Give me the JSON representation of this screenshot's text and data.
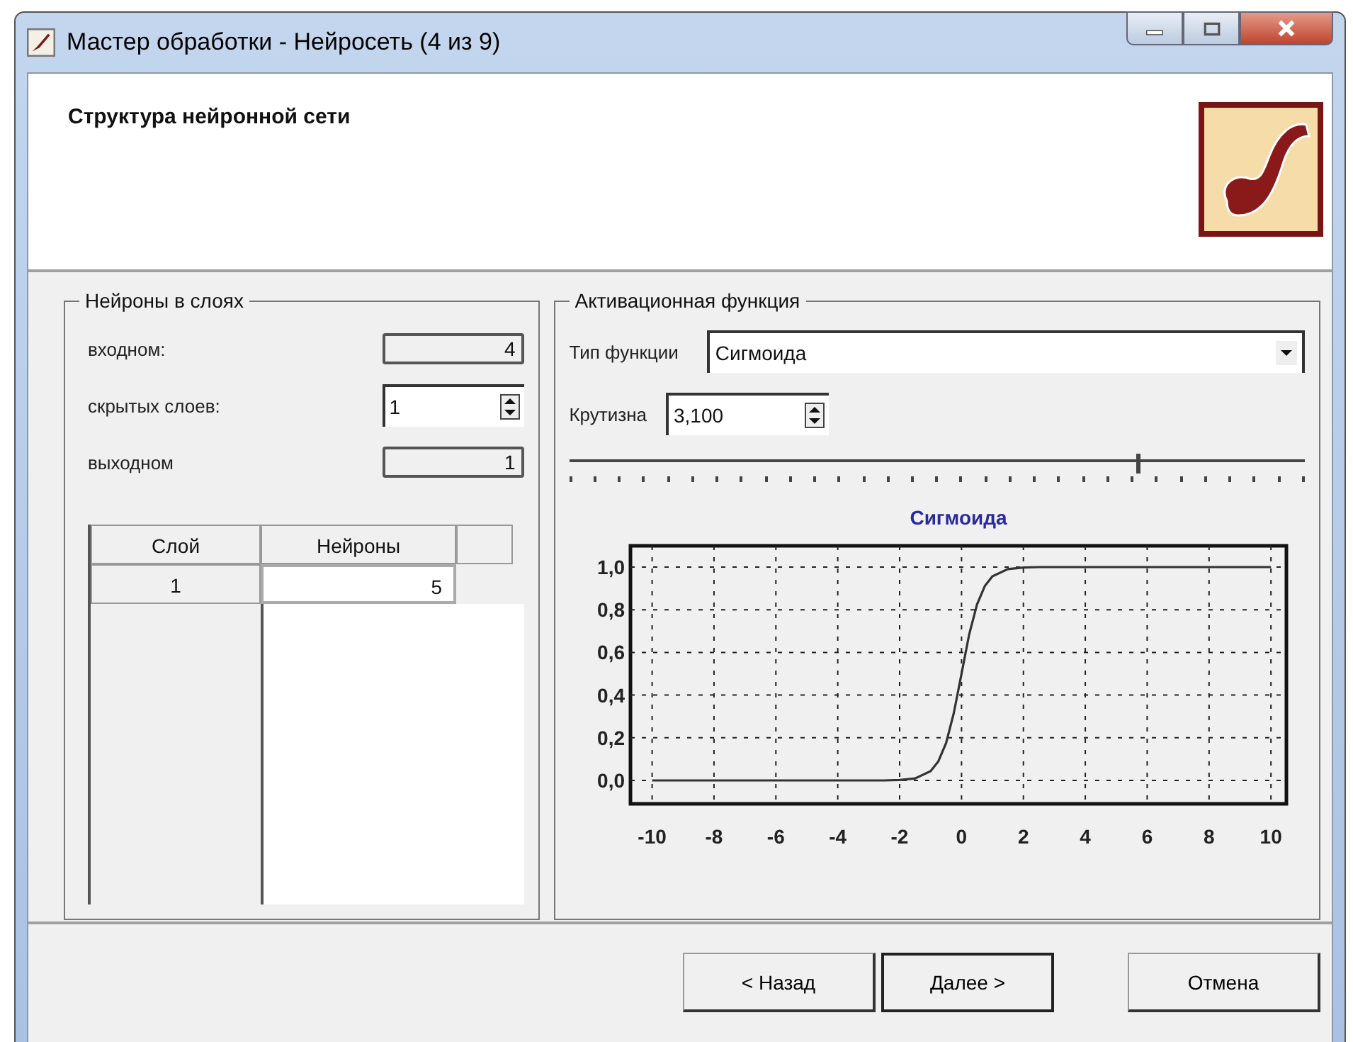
{
  "window": {
    "title": "Мастер обработки - Нейросеть (4 из 9)"
  },
  "header": {
    "title": "Структура нейронной сети"
  },
  "neurons_group": {
    "title": "Нейроны в слоях",
    "fields": [
      {
        "kind": "readonly",
        "label": "входном:",
        "value": "4"
      },
      {
        "kind": "spin",
        "label": "скрытых слоев:",
        "value": "1"
      },
      {
        "kind": "readonly",
        "label": "выходном",
        "value": "1"
      }
    ],
    "table": {
      "columns": [
        "Слой",
        "Нейроны"
      ],
      "rows": [
        [
          "1",
          "5"
        ]
      ]
    }
  },
  "activation_group": {
    "title": "Активационная функция",
    "function_type": {
      "label": "Тип функции",
      "value": "Сигмоида"
    },
    "steepness": {
      "label": "Крутизна",
      "value": "3,100"
    },
    "slider": {
      "level": 0.77
    },
    "chart_data": {
      "type": "line",
      "title": "Сигмоида",
      "x": [
        -10,
        -8,
        -6,
        -4,
        -3,
        -2.5,
        -2,
        -1.5,
        -1,
        -0.75,
        -0.5,
        -0.25,
        0,
        0.25,
        0.5,
        0.75,
        1,
        1.5,
        2,
        2.5,
        3,
        4,
        6,
        8,
        10
      ],
      "grid": true,
      "series": [
        {
          "color": "#333333",
          "values": [
            0,
            0,
            0,
            0,
            0,
            0,
            0.002,
            0.009,
            0.043,
            0.089,
            0.175,
            0.315,
            0.5,
            0.685,
            0.825,
            0.911,
            0.957,
            0.991,
            0.998,
            1,
            1,
            1,
            1,
            1,
            1
          ]
        }
      ],
      "xlim": [
        -10.7,
        10.5
      ],
      "ylim": [
        -0.11,
        1.1
      ],
      "xticks": [
        -10,
        -8,
        -6,
        -4,
        -2,
        0,
        2,
        4,
        6,
        8,
        10
      ],
      "yticks": [
        {
          "value": 0,
          "label": "0,0"
        },
        {
          "value": 0.2,
          "label": "0,2"
        },
        {
          "value": 0.4,
          "label": "0,4"
        },
        {
          "value": 0.6,
          "label": "0,6"
        },
        {
          "value": 0.8,
          "label": "0,8"
        },
        {
          "value": 1,
          "label": "1,0"
        }
      ]
    }
  },
  "buttons": [
    {
      "label": "< Назад",
      "default": false
    },
    {
      "label": "Далее >",
      "default": true
    },
    {
      "label": "Отмена",
      "default": false
    }
  ]
}
